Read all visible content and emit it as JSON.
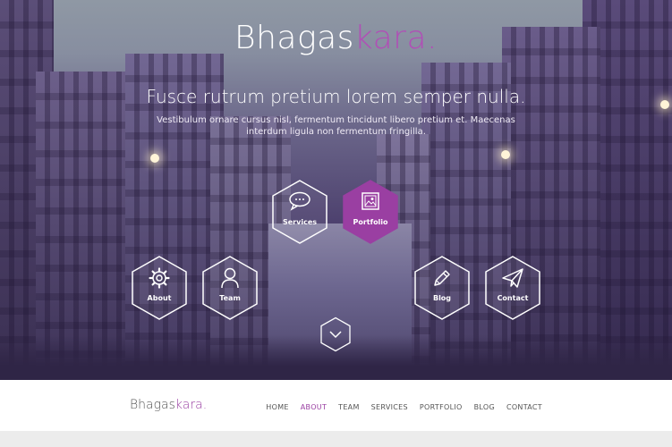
{
  "brand": {
    "name_main": "Bhagas",
    "name_accent": "kara",
    "dot": "."
  },
  "hero": {
    "headline": "Fusce rutrum pretium lorem semper nulla.",
    "subtext": "Vestibulum ornare cursus nisl, fermentum tincidunt libero pretium et. Maecenas interdum ligula non fermentum fringilla."
  },
  "tiles": [
    {
      "label": "Services",
      "icon": "speech-bubble-icon",
      "active": false
    },
    {
      "label": "Portfolio",
      "icon": "picture-icon",
      "active": true
    },
    {
      "label": "About",
      "icon": "gear-icon",
      "active": false
    },
    {
      "label": "Team",
      "icon": "person-icon",
      "active": false
    },
    {
      "label": "Blog",
      "icon": "pencil-icon",
      "active": false
    },
    {
      "label": "Contact",
      "icon": "paper-plane-icon",
      "active": false
    }
  ],
  "scroll_down": {
    "icon": "chevron-down-icon"
  },
  "nav": {
    "items": [
      "HOME",
      "ABOUT",
      "TEAM",
      "SERVICES",
      "PORTFOLIO",
      "BLOG",
      "CONTACT"
    ],
    "active": "ABOUT"
  },
  "colors": {
    "accent": "#9a3fa2",
    "white": "#ffffff"
  }
}
